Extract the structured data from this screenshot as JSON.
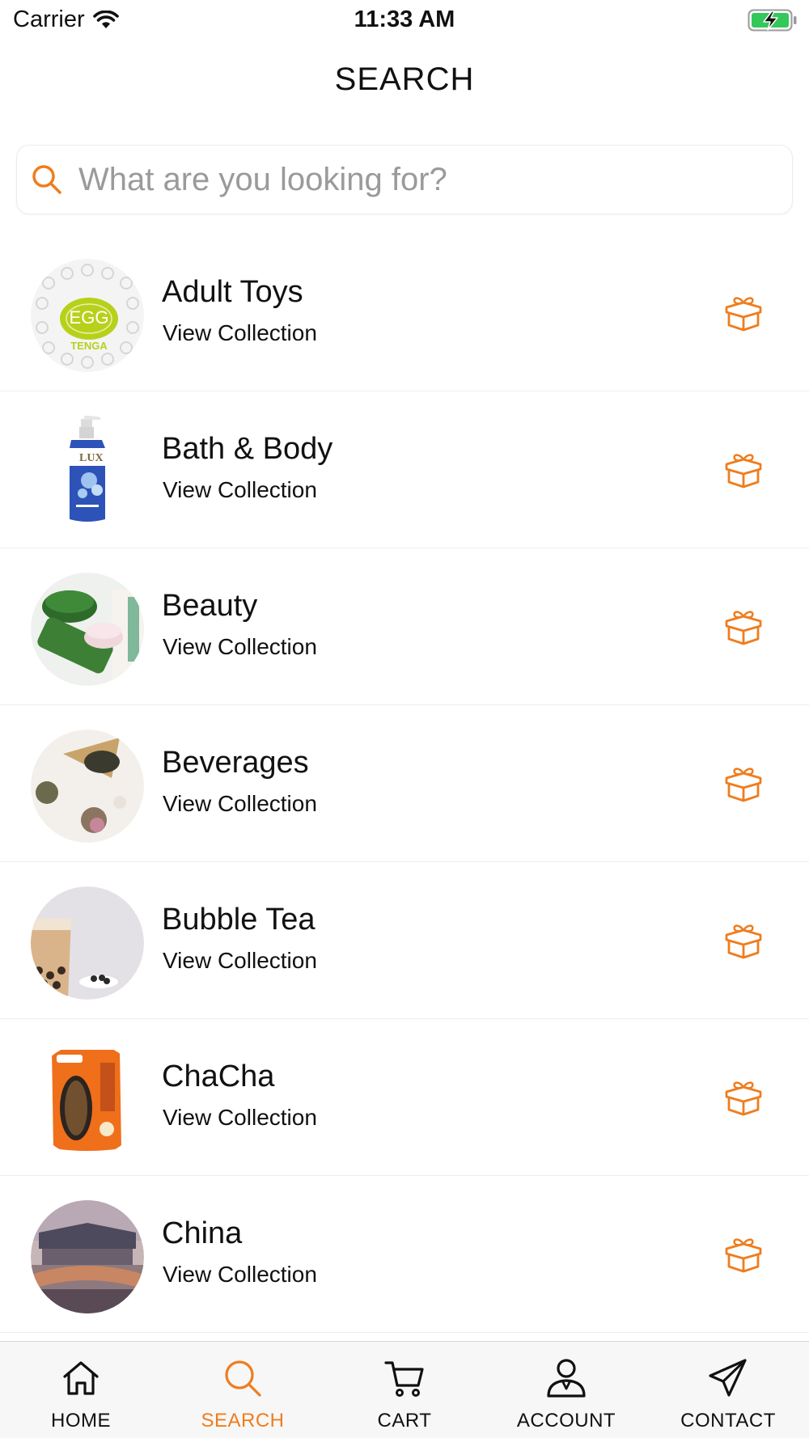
{
  "status_bar": {
    "carrier": "Carrier",
    "time": "11:33 AM"
  },
  "colors": {
    "accent": "#ef7d1e",
    "text": "#111111",
    "placeholder": "#9a9a9a",
    "divider": "#eeeeee",
    "tab_bar_bg": "#f7f7f7",
    "battery_green": "#34c759"
  },
  "header": {
    "title": "SEARCH"
  },
  "search": {
    "placeholder": "What are you looking for?",
    "value": "",
    "icon": "search-icon"
  },
  "collections": [
    {
      "title": "Adult Toys",
      "subtitle": "View Collection",
      "icon": "gift-box-icon"
    },
    {
      "title": "Bath & Body",
      "subtitle": "View Collection",
      "icon": "gift-box-icon"
    },
    {
      "title": "Beauty",
      "subtitle": "View Collection",
      "icon": "gift-box-icon"
    },
    {
      "title": "Beverages",
      "subtitle": "View Collection",
      "icon": "gift-box-icon"
    },
    {
      "title": "Bubble Tea",
      "subtitle": "View Collection",
      "icon": "gift-box-icon"
    },
    {
      "title": "ChaCha",
      "subtitle": "View Collection",
      "icon": "gift-box-icon"
    },
    {
      "title": "China",
      "subtitle": "View Collection",
      "icon": "gift-box-icon"
    }
  ],
  "tab_bar": {
    "active": "search",
    "tabs": [
      {
        "id": "home",
        "label": "HOME",
        "icon": "home-icon"
      },
      {
        "id": "search",
        "label": "SEARCH",
        "icon": "search-icon"
      },
      {
        "id": "cart",
        "label": "CART",
        "icon": "cart-icon"
      },
      {
        "id": "account",
        "label": "ACCOUNT",
        "icon": "account-icon"
      },
      {
        "id": "contact",
        "label": "CONTACT",
        "icon": "paper-plane-icon"
      }
    ]
  }
}
